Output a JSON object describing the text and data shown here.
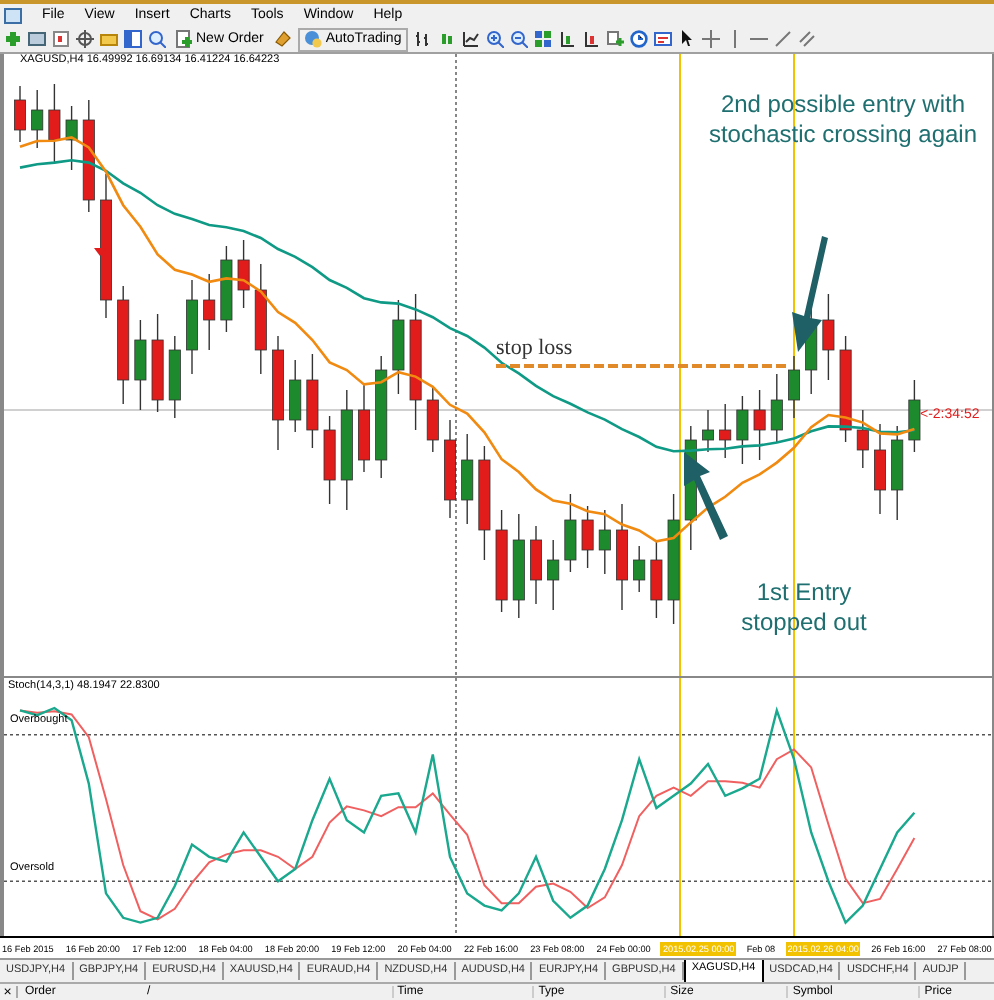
{
  "menu": [
    "File",
    "View",
    "Insert",
    "Charts",
    "Tools",
    "Window",
    "Help"
  ],
  "toolbar": {
    "new_order": "New Order",
    "autotrading": "AutoTrading"
  },
  "chart": {
    "header": "XAGUSD,H4 16.49992 16.69134 16.41224 16.64223",
    "countdown": "<-2:34:52",
    "note_top": "2nd possible entry with stochastic crossing again",
    "stop_loss": "stop loss",
    "note_bottom": "1st Entry stopped out"
  },
  "indicator": {
    "label": "Stoch(14,3,1) 48.1947 22.8300",
    "overbought": "Overbought",
    "oversold": "Oversold"
  },
  "time_axis": [
    {
      "label": "16 Feb 2015",
      "highlighted": false
    },
    {
      "label": "16 Feb 20:00",
      "highlighted": false
    },
    {
      "label": "17 Feb 12:00",
      "highlighted": false
    },
    {
      "label": "18 Feb 04:00",
      "highlighted": false
    },
    {
      "label": "18 Feb 20:00",
      "highlighted": false
    },
    {
      "label": "19 Feb 12:00",
      "highlighted": false
    },
    {
      "label": "20 Feb 04:00",
      "highlighted": false
    },
    {
      "label": "22 Feb 16:00",
      "highlighted": false
    },
    {
      "label": "23 Feb 08:00",
      "highlighted": false
    },
    {
      "label": "24 Feb 00:00",
      "highlighted": false
    },
    {
      "label": "2015.02.25 00:00",
      "highlighted": true
    },
    {
      "label": "Feb 08",
      "highlighted": false
    },
    {
      "label": "2015.02.26 04:00",
      "highlighted": true
    },
    {
      "label": "26 Feb 16:00",
      "highlighted": false
    },
    {
      "label": "27 Feb 08:00",
      "highlighted": false
    }
  ],
  "symbol_tabs": [
    {
      "label": "USDJPY,H4",
      "selected": false
    },
    {
      "label": "GBPJPY,H4",
      "selected": false
    },
    {
      "label": "EURUSD,H4",
      "selected": false
    },
    {
      "label": "XAUUSD,H4",
      "selected": false
    },
    {
      "label": "EURAUD,H4",
      "selected": false
    },
    {
      "label": "NZDUSD,H4",
      "selected": false
    },
    {
      "label": "AUDUSD,H4",
      "selected": false
    },
    {
      "label": "EURJPY,H4",
      "selected": false
    },
    {
      "label": "GBPUSD,H4",
      "selected": false
    },
    {
      "label": "XAGUSD,H4",
      "selected": true
    },
    {
      "label": "USDCAD,H4",
      "selected": false
    },
    {
      "label": "USDCHF,H4",
      "selected": false
    },
    {
      "label": "AUDJP",
      "selected": false
    }
  ],
  "terminal": {
    "close": "×",
    "sort_mark": "/",
    "columns": [
      "Order",
      "Time",
      "Type",
      "Size",
      "Symbol",
      "Price"
    ]
  }
}
